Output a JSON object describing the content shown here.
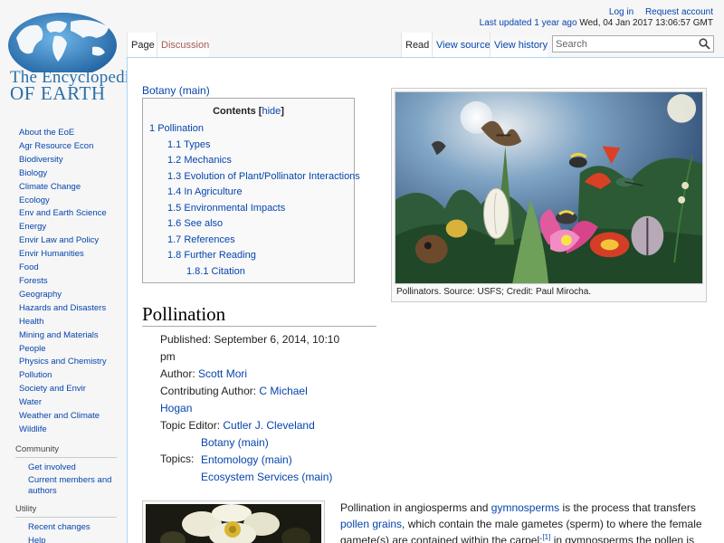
{
  "logo": {
    "line1": "The Encyclopedia",
    "line2": "OF EARTH"
  },
  "sidebar": {
    "nav": [
      "About the EoE",
      "Agr Resource Econ",
      "Biodiversity",
      "Biology",
      "Climate Change",
      "Ecology",
      "Env and Earth Science",
      "Energy",
      "Envir Law and Policy",
      "Envir Humanities",
      "Food",
      "Forests",
      "Geography",
      "Hazards and Disasters",
      "Health",
      "Mining and Materials",
      "People",
      "Physics and Chemistry",
      "Pollution",
      "Society and Envir",
      "Water",
      "Weather and Climate",
      "Wildlife"
    ],
    "community": {
      "heading": "Community",
      "items": [
        "Get involved",
        "Current members and authors"
      ]
    },
    "utility": {
      "heading": "Utility",
      "items": [
        "Recent changes",
        "Help"
      ]
    }
  },
  "personal": {
    "login": "Log in",
    "request": "Request account",
    "updated_link": "Last updated 1 year ago",
    "updated_date": "Wed, 04 Jan 2017 13:06:57 GMT"
  },
  "tabs": {
    "page": "Page",
    "discussion": "Discussion",
    "read": "Read",
    "view_source": "View source",
    "view_history": "View history"
  },
  "search": {
    "placeholder": "Search"
  },
  "content": {
    "category_link": "Botany (main)",
    "toc": {
      "title": "Contents",
      "hide": "hide",
      "items": [
        {
          "num": "1",
          "text": "Pollination"
        },
        {
          "num": "1.1",
          "text": "Types"
        },
        {
          "num": "1.2",
          "text": "Mechanics"
        },
        {
          "num": "1.3",
          "text": "Evolution of Plant/Pollinator Interactions"
        },
        {
          "num": "1.4",
          "text": "In Agriculture"
        },
        {
          "num": "1.5",
          "text": "Environmental Impacts"
        },
        {
          "num": "1.6",
          "text": "See also"
        },
        {
          "num": "1.7",
          "text": "References"
        },
        {
          "num": "1.8",
          "text": "Further Reading"
        },
        {
          "num": "1.8.1",
          "text": "Citation"
        }
      ]
    },
    "figure_caption": "Pollinators. Source: USFS; Credit: Paul Mirocha.",
    "heading": "Pollination",
    "meta": {
      "published_label": "Published:",
      "published_value": "September 6, 2014, 10:10 pm",
      "author_label": "Author:",
      "author": "Scott Mori",
      "contrib_label": "Contributing Author:",
      "contrib_author": "C Michael Hogan",
      "editor_label": "Topic Editor:",
      "editor": "Cutler J. Cleveland",
      "topics_label": "Topics:",
      "topics": [
        "Botany (main)",
        "Entomology (main)",
        "Ecosystem Services (main)"
      ]
    },
    "paragraph": {
      "t1": "Pollination in angiosperms and ",
      "l1": "gymnosperms",
      "t2": " is the process that transfers ",
      "l2": "pollen grains",
      "t3": ", which contain the male gametes (sperm) to where the female gamete(s) are contained within the carpel;",
      "ref": "[1]",
      "t4": " in gymnosperms the pollen is directly applied to the"
    }
  }
}
